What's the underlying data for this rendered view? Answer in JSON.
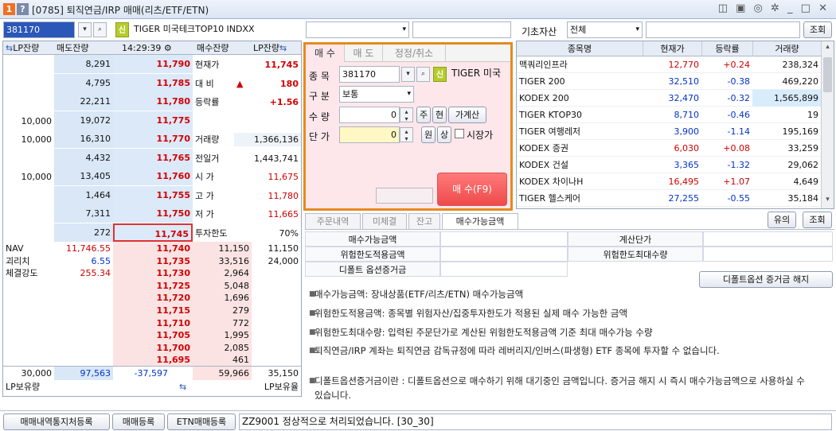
{
  "window": {
    "number": "1",
    "help": "?",
    "title": "[0785] 퇴직연금/IRP 매매(리츠/ETF/ETN)",
    "controls": "◫ ▣ ◎ ✲ _ □ ✕"
  },
  "toolbar": {
    "code": "381170",
    "sin": "신",
    "name": "TIGER 미국테크TOP10 INDXX",
    "base_label": "기초자산",
    "base_value": "전체",
    "query": "조회"
  },
  "hoga": {
    "headers": {
      "lp_left": "LP잔량",
      "sell_qty": "매도잔량",
      "time": "14:29:39",
      "buy_qty": "매수잔량",
      "lp_right": "LP잔량"
    },
    "sell_rows": [
      {
        "lp": "",
        "qty": "8,291",
        "price": "11,790"
      },
      {
        "lp": "",
        "qty": "4,795",
        "price": "11,785"
      },
      {
        "lp": "",
        "qty": "22,211",
        "price": "11,780"
      },
      {
        "lp": "10,000",
        "qty": "19,072",
        "price": "11,775"
      },
      {
        "lp": "10,000",
        "qty": "16,310",
        "price": "11,770"
      },
      {
        "lp": "",
        "qty": "4,432",
        "price": "11,765"
      },
      {
        "lp": "10,000",
        "qty": "13,405",
        "price": "11,760"
      },
      {
        "lp": "",
        "qty": "1,464",
        "price": "11,755"
      },
      {
        "lp": "",
        "qty": "7,311",
        "price": "11,750"
      },
      {
        "lp": "",
        "qty": "272",
        "price": "11,745"
      }
    ],
    "info": [
      {
        "label": "현재가",
        "value": "11,745"
      },
      {
        "label": "대 비",
        "arrow": "▲",
        "value": "180"
      },
      {
        "label": "등락률",
        "value": "+1.56"
      },
      {
        "label": "",
        "value": ""
      },
      {
        "label": "거래량",
        "value": "1,366,136"
      },
      {
        "label": "전일거",
        "value": "1,443,741"
      },
      {
        "label": "시 가",
        "value": "11,675"
      },
      {
        "label": "고 가",
        "value": "11,780"
      },
      {
        "label": "저 가",
        "value": "11,665"
      },
      {
        "label": "투자한도",
        "value": "70%"
      }
    ],
    "buy_rows": [
      {
        "price": "11,740",
        "qty": "11,150",
        "lp": "11,150"
      },
      {
        "price": "11,735",
        "qty": "33,516",
        "lp": "24,000"
      },
      {
        "price": "11,730",
        "qty": "2,964",
        "lp": ""
      },
      {
        "price": "11,725",
        "qty": "5,048",
        "lp": ""
      },
      {
        "price": "11,720",
        "qty": "1,696",
        "lp": ""
      },
      {
        "price": "11,715",
        "qty": "279",
        "lp": ""
      },
      {
        "price": "11,710",
        "qty": "772",
        "lp": ""
      },
      {
        "price": "11,705",
        "qty": "1,995",
        "lp": ""
      },
      {
        "price": "11,700",
        "qty": "2,085",
        "lp": ""
      },
      {
        "price": "11,695",
        "qty": "461",
        "lp": ""
      }
    ],
    "left_info": [
      {
        "label": "NAV",
        "value": "11,746.55"
      },
      {
        "label": "괴리치",
        "value": "6.55"
      },
      {
        "label": "체결강도",
        "value": "255.34"
      }
    ],
    "footer": {
      "lp_total_left": "30,000",
      "sell_total": "97,563",
      "diff": "-37,597",
      "buy_total": "59,966",
      "lp_total_right": "35,150",
      "lp_hold": "LP보유량",
      "lp_rate": "LP보유율"
    }
  },
  "order": {
    "tabs": [
      "매 수",
      "매 도",
      "정정/취소"
    ],
    "code_label": "종 목",
    "code": "381170",
    "sin": "신",
    "name": "TIGER 미국",
    "type_label": "구 분",
    "type_value": "보통",
    "qty_label": "수 량",
    "qty_value": "0",
    "qty_btn1": "주",
    "qty_btn2": "현",
    "qty_btn3": "가계산",
    "price_label": "단 가",
    "price_value": "0",
    "price_btn1": "원",
    "price_btn2": "상",
    "market_label": "시장가",
    "buy_button": "매 수(F9)"
  },
  "stocklist": {
    "headers": [
      "종목명",
      "현재가",
      "등락률",
      "거래량"
    ],
    "rows": [
      {
        "name": "맥쿼리인프라",
        "price": "12,770",
        "rate": "+0.24",
        "vol": "238,324",
        "dir": "up"
      },
      {
        "name": "TIGER 200",
        "price": "32,510",
        "rate": "-0.38",
        "vol": "469,220",
        "dir": "down"
      },
      {
        "name": "KODEX 200",
        "price": "32,470",
        "rate": "-0.32",
        "vol": "1,565,899",
        "dir": "down"
      },
      {
        "name": "TIGER KTOP30",
        "price": "8,710",
        "rate": "-0.46",
        "vol": "19",
        "dir": "down"
      },
      {
        "name": "TIGER 여행레저",
        "price": "3,900",
        "rate": "-1.14",
        "vol": "195,169",
        "dir": "down"
      },
      {
        "name": "KODEX 증권",
        "price": "6,030",
        "rate": "+0.08",
        "vol": "33,259",
        "dir": "up"
      },
      {
        "name": "KODEX 건설",
        "price": "3,365",
        "rate": "-1.32",
        "vol": "29,062",
        "dir": "down"
      },
      {
        "name": "KODEX 차이나H",
        "price": "16,495",
        "rate": "+1.07",
        "vol": "4,649",
        "dir": "up"
      },
      {
        "name": "TIGER 헬스케어",
        "price": "27,255",
        "rate": "-0.55",
        "vol": "35,184",
        "dir": "down"
      }
    ]
  },
  "bottom": {
    "tabs": [
      "주문내역",
      "미체결",
      "잔고",
      "매수가능금액"
    ],
    "btn_warn": "유의",
    "btn_query": "조회",
    "grid": {
      "c1": "매수가능금액",
      "c2": "위험한도적용금액",
      "c3": "디폴트 옵션증거금",
      "c4": "계산단가",
      "c5": "위험한도최대수량"
    },
    "release_button": "디폴트옵션 증거금 해지",
    "notes": [
      "매수가능금액: 장내상품(ETF/리츠/ETN) 매수가능금액",
      "위험한도적용금액: 종목별 위험자산/집중투자한도가 적용된 실제 매수 가능한 금액",
      "위험한도최대수량: 입력된 주문단가로 계산된 위험한도적용금액 기준 최대 매수가능 수량",
      "퇴직연금/IRP 계좌는 퇴직연금 감독규정에 따라 레버리지/인버스(파생형) ETF 종목에 투자할 수 없습니다.",
      "디폴트옵션증거금이란 : 디폴트옵션으로 매수하기 위해 대기중인 금액입니다. 증거금 해지 시 즉시 매수가능금액으로 사용하실 수 있습니다."
    ]
  },
  "statusbar": {
    "btn1": "매매내역통지처등록",
    "btn2": "매매등록",
    "btn3": "ETN매매등록",
    "message": "ZZ9001 정상적으로 처리되었습니다. [30_30]"
  }
}
